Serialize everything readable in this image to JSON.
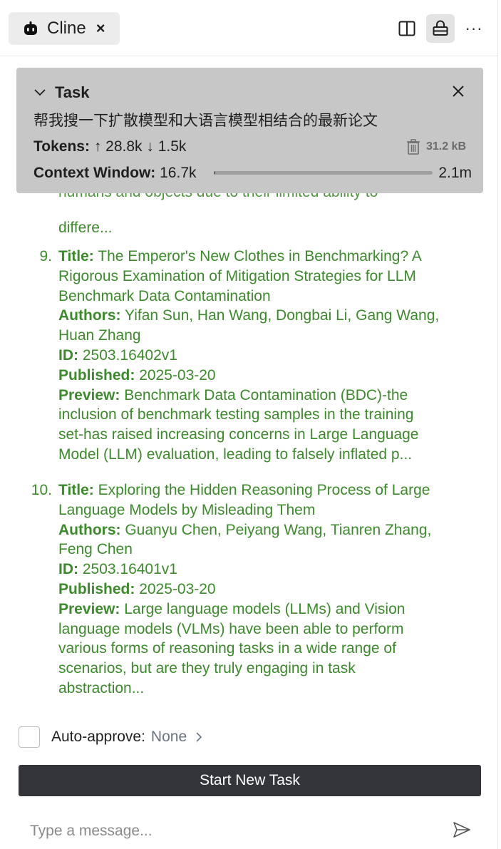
{
  "tab": {
    "label": "Cline",
    "close_glyph": "×",
    "icon": "robot-icon"
  },
  "toolbar": {
    "split_icon": "split-editor-icon",
    "lock_icon": "lock-icon",
    "more_glyph": "···"
  },
  "task": {
    "title": "Task",
    "text": "帮我搜一下扩散模型和大语言模型相结合的最新论文",
    "tokens_label": "Tokens:",
    "tokens_up": "↑ 28.8k",
    "tokens_down": "↓ 1.5k",
    "size": "31.2 kB",
    "context_label": "Context Window:",
    "context_used": "16.7k",
    "context_max": "2.1m",
    "context_fraction": 0.008
  },
  "results": {
    "prev_cut_line": "humans and objects due to their limited ability to",
    "prev_tail": "differe...",
    "papers": [
      {
        "number": "9.",
        "title_label": "Title:",
        "title_lines": [
          "The Emperor's New Clothes in Benchmarking? A",
          "Rigorous Examination of Mitigation Strategies for LLM",
          "Benchmark Data Contamination"
        ],
        "authors_label": "Authors:",
        "authors_lines": [
          "Yifan Sun, Han Wang, Dongbai Li, Gang Wang,",
          "Huan Zhang"
        ],
        "id_label": "ID:",
        "id": "2503.16402v1",
        "published_label": "Published:",
        "published": "2025-03-20",
        "preview_label": "Preview:",
        "preview_lines": [
          "Benchmark Data Contamination (BDC)-the",
          "inclusion of benchmark testing samples in the training",
          "set-has raised increasing concerns in Large Language",
          "Model (LLM) evaluation, leading to falsely inflated p..."
        ]
      },
      {
        "number": "10.",
        "title_label": "Title:",
        "title_lines": [
          "Exploring the Hidden Reasoning Process of Large",
          "Language Models by Misleading Them"
        ],
        "authors_label": "Authors:",
        "authors_lines": [
          "Guanyu Chen, Peiyang Wang, Tianren Zhang,",
          "Feng Chen"
        ],
        "id_label": "ID:",
        "id": "2503.16401v1",
        "published_label": "Published:",
        "published": "2025-03-20",
        "preview_label": "Preview:",
        "preview_lines": [
          "Large language models (LLMs) and Vision",
          "language models (VLMs) have been able to perform",
          "various forms of reasoning tasks in a wide range of",
          "scenarios, but are they truly engaging in task",
          "abstraction..."
        ]
      }
    ]
  },
  "auto_approve": {
    "label": "Auto-approve:",
    "value": "None",
    "chevron": "›"
  },
  "start_button": {
    "label": "Start New Task"
  },
  "message": {
    "placeholder": "Type a message..."
  },
  "colors": {
    "result_text": "#3c8a2c",
    "task_panel_bg": "#c7c7c7",
    "button_bg": "#33353a"
  }
}
